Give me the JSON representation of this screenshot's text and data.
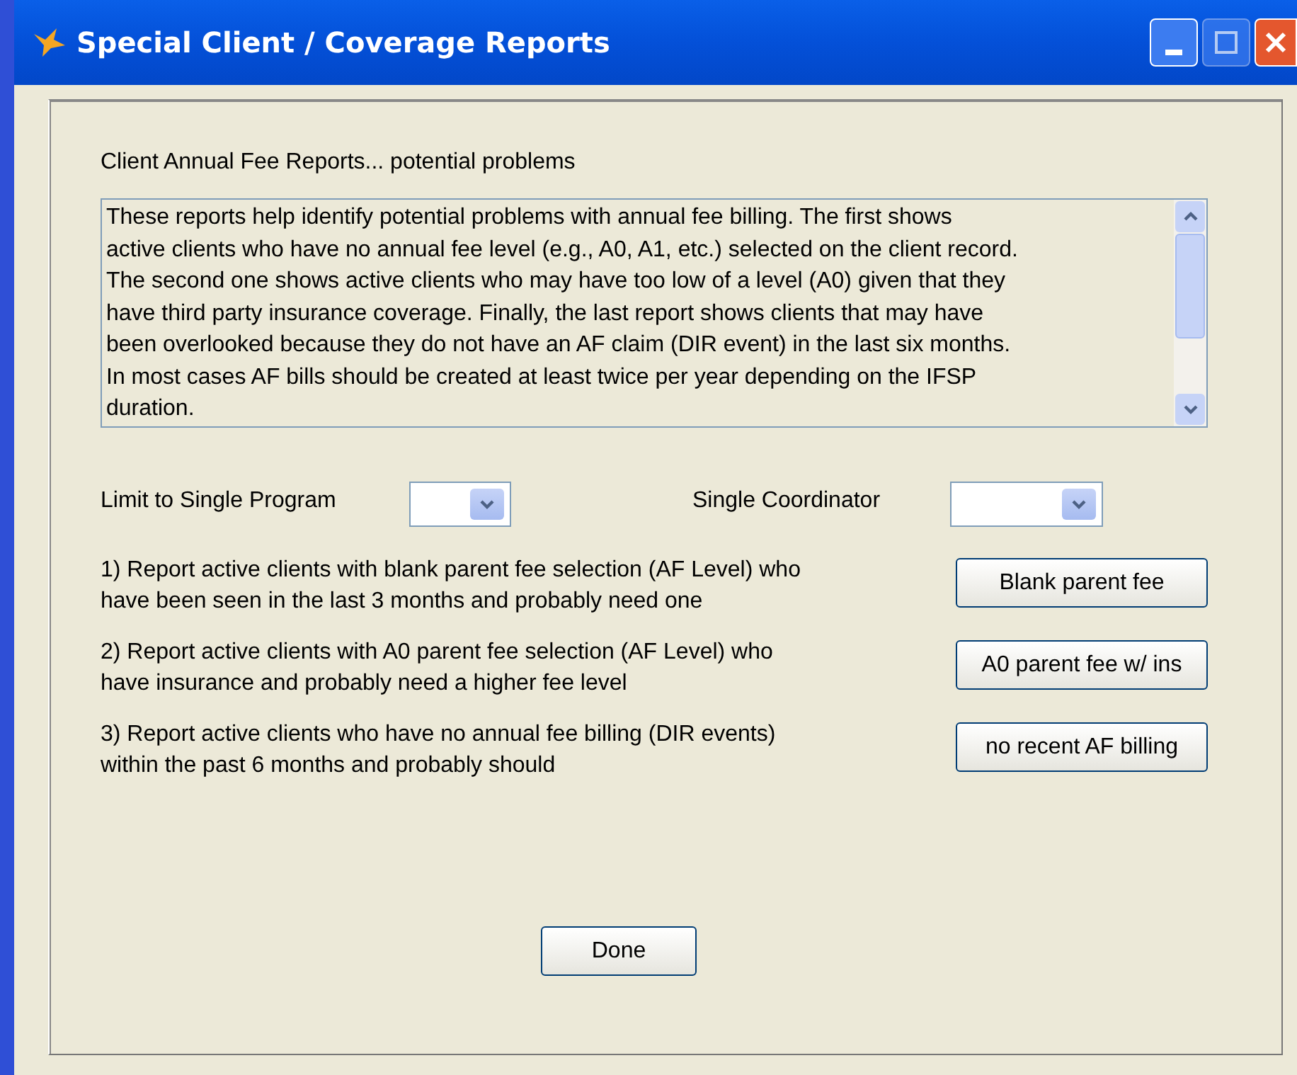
{
  "window": {
    "title": "Special Client / Coverage Reports"
  },
  "section_title": "Client Annual Fee Reports... potential problems",
  "description_lines": [
    "These reports help identify potential problems with annual fee billing.  The first shows",
    "active clients who have no annual fee level (e.g., A0, A1, etc.) selected on the client record.",
    "The second one shows active clients who may have too low of a level (A0) given that they",
    "have third party insurance coverage.  Finally, the last report shows clients that may have",
    "been overlooked because they do not have an AF claim (DIR event) in the last six months.",
    "In most cases AF bills should be created at least twice per year depending on the IFSP",
    "duration."
  ],
  "filters": [
    {
      "label": "Limit to Single Program"
    },
    {
      "label": "Single Coordinator"
    }
  ],
  "reports": [
    {
      "lines": [
        "1)  Report active clients with blank parent fee selection (AF Level) who",
        "have been seen in the last 3 months and probably need one"
      ],
      "button": "Blank parent fee"
    },
    {
      "lines": [
        "2)  Report active clients with A0 parent fee selection (AF Level) who",
        "have insurance and probably need a higher fee level"
      ],
      "button": "A0 parent fee w/ ins"
    },
    {
      "lines": [
        "3)  Report active clients who have no annual fee billing (DIR events)",
        "within the past 6 months and probably should"
      ],
      "button": "no recent AF billing"
    }
  ],
  "done_button": "Done"
}
